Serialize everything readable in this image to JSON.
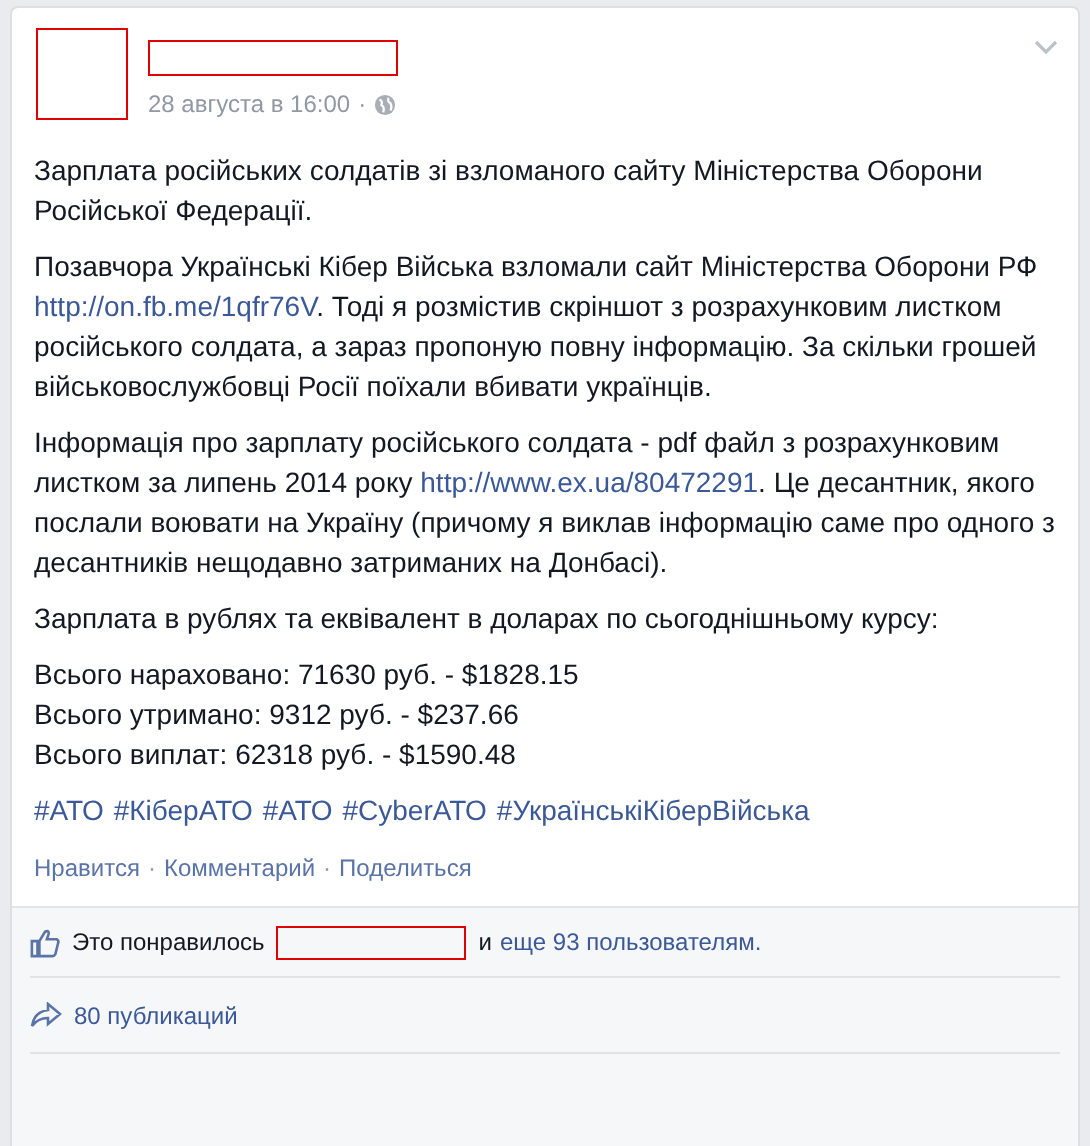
{
  "post": {
    "timestamp": "28 августа в 16:00",
    "separator": "·",
    "paragraphs": [
      [
        {
          "kind": "text",
          "text": "Зарплата російських солдатів зі взломаного сайту Міністерства Оборони Російської Федерації."
        }
      ],
      [
        {
          "kind": "text",
          "text": "Позавчора Українські Кібер Війська взломали сайт Міністерства Оборони РФ "
        },
        {
          "kind": "link",
          "text": "http://on.fb.me/1qfr76V"
        },
        {
          "kind": "text",
          "text": ". Тоді я розмістив скрiншот з розрахунковим листком російського солдата, а зараз пропоную повну інформацію. За скільки грошей військовослужбовці Росії поїхали вбивати українців."
        }
      ],
      [
        {
          "kind": "text",
          "text": "Інформація про зарплату російського солдата - pdf файл з розрахунковим листком за липень 2014 року "
        },
        {
          "kind": "link",
          "text": "http://www.ex.ua/80472291"
        },
        {
          "kind": "text",
          "text": ". Це десантник, якого послали воювати на Україну (причому я виклав інформацію саме про одного з десантників нещодавно затриманих на Донбасі)."
        }
      ],
      [
        {
          "kind": "text",
          "text": "Зарплата в рублях та еквівалент в доларах по сьогоднішньому курсу:"
        }
      ]
    ],
    "amounts": [
      "Всього нараховано: 71630 руб. - $1828.15",
      "Всього утримано: 9312 руб. - $237.66",
      "Всього виплат: 62318 руб. - $1590.48"
    ],
    "hashtags": [
      "#АТО",
      "#КіберАТО",
      "#АТО",
      "#CyberАТО",
      "#УкраїнськіКіберВійська"
    ],
    "actions": [
      "Нравится",
      "Комментарий",
      "Поделиться"
    ],
    "likes": {
      "prefix": "Это понравилось",
      "middle": "и",
      "link": "еще 93 пользователям."
    },
    "shares": "80 публикаций"
  }
}
